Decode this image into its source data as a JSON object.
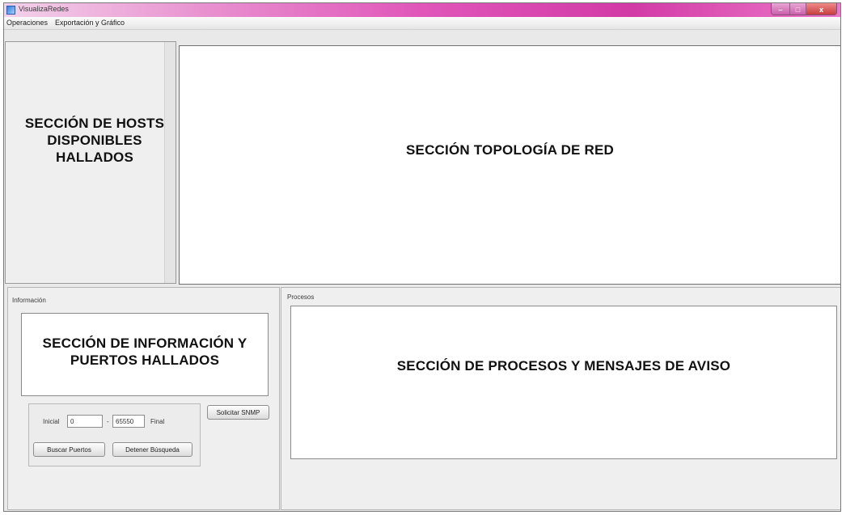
{
  "window": {
    "title": "VisualizaRedes",
    "controls": {
      "minimize": "–",
      "maximize": "□",
      "close": "x"
    }
  },
  "menu": {
    "items": [
      "Operaciones",
      "Exportación y Gráfico"
    ]
  },
  "hosts_section": {
    "label_lines": [
      "SECCIÓN DE HOSTS",
      "DISPONIBLES",
      "HALLADOS"
    ]
  },
  "topology_section": {
    "label": "SECCIÓN TOPOLOGÍA DE RED"
  },
  "info_panel": {
    "title": "Información",
    "label_lines": [
      "SECCIÓN DE INFORMACIÓN Y",
      "PUERTOS HALLADOS"
    ],
    "inicial_label": "Inicial",
    "inicial_value": "0",
    "separator": "-",
    "final_value": "65550",
    "final_label": "Final",
    "buttons": {
      "solicitar_snmp": "Solicitar SNMP",
      "buscar_puertos": "Buscar Puertos",
      "detener_busqueda": "Detener Búsqueda"
    }
  },
  "process_panel": {
    "title": "Procesos",
    "label": "SECCIÓN DE PROCESOS Y MENSAJES DE AVISO"
  }
}
